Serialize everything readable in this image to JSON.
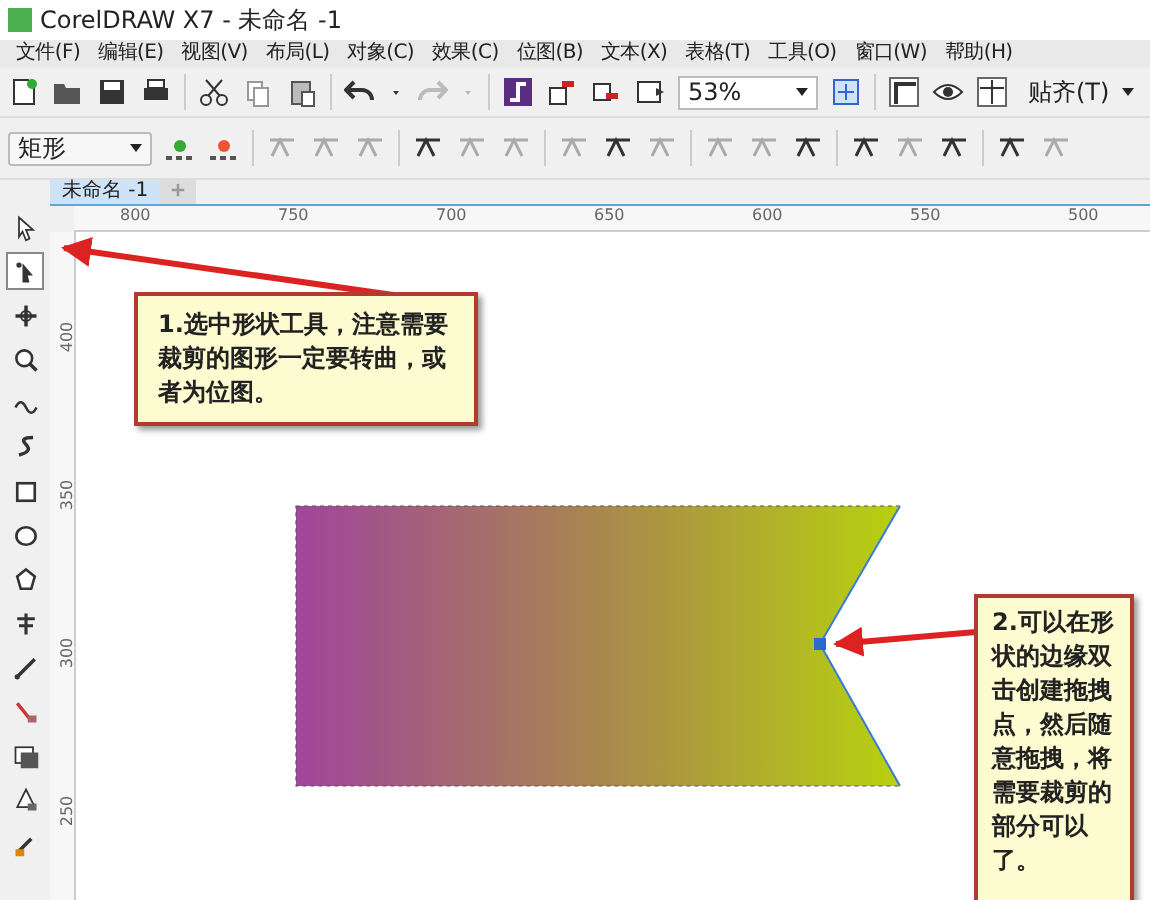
{
  "window": {
    "title": "CorelDRAW X7 - 未命名 -1"
  },
  "menu": [
    "文件(F)",
    "编辑(E)",
    "视图(V)",
    "布局(L)",
    "对象(C)",
    "效果(C)",
    "位图(B)",
    "文本(X)",
    "表格(T)",
    "工具(O)",
    "窗口(W)",
    "帮助(H)"
  ],
  "standard_toolbar": {
    "zoom": "53%",
    "snap": "贴齐(T)"
  },
  "property_bar": {
    "shape_type": "矩形"
  },
  "document_tabs": [
    {
      "label": "未命名 -1",
      "selected": true
    }
  ],
  "rulers": {
    "horizontal": [
      "800",
      "750",
      "700",
      "650",
      "600",
      "550",
      "500"
    ],
    "vertical": [
      "400",
      "350",
      "300",
      "250"
    ]
  },
  "toolbox": [
    {
      "selected": false
    },
    {
      "selected": true
    },
    {
      "selected": false
    },
    {
      "selected": false
    },
    {
      "selected": false
    },
    {
      "selected": false
    },
    {
      "selected": false
    },
    {
      "selected": false
    },
    {
      "selected": false
    },
    {
      "selected": false
    },
    {
      "selected": false
    },
    {
      "selected": false
    },
    {
      "selected": false
    },
    {
      "selected": false
    },
    {
      "selected": false
    }
  ],
  "callouts": [
    {
      "text": "1.选中形状工具，注意需要裁剪的图形一定要转曲，或者为位图。"
    },
    {
      "text": "2.可以在形状的边缘双击创建拖拽点，然后随意拖拽，将需要裁剪的部分可以了。"
    }
  ]
}
